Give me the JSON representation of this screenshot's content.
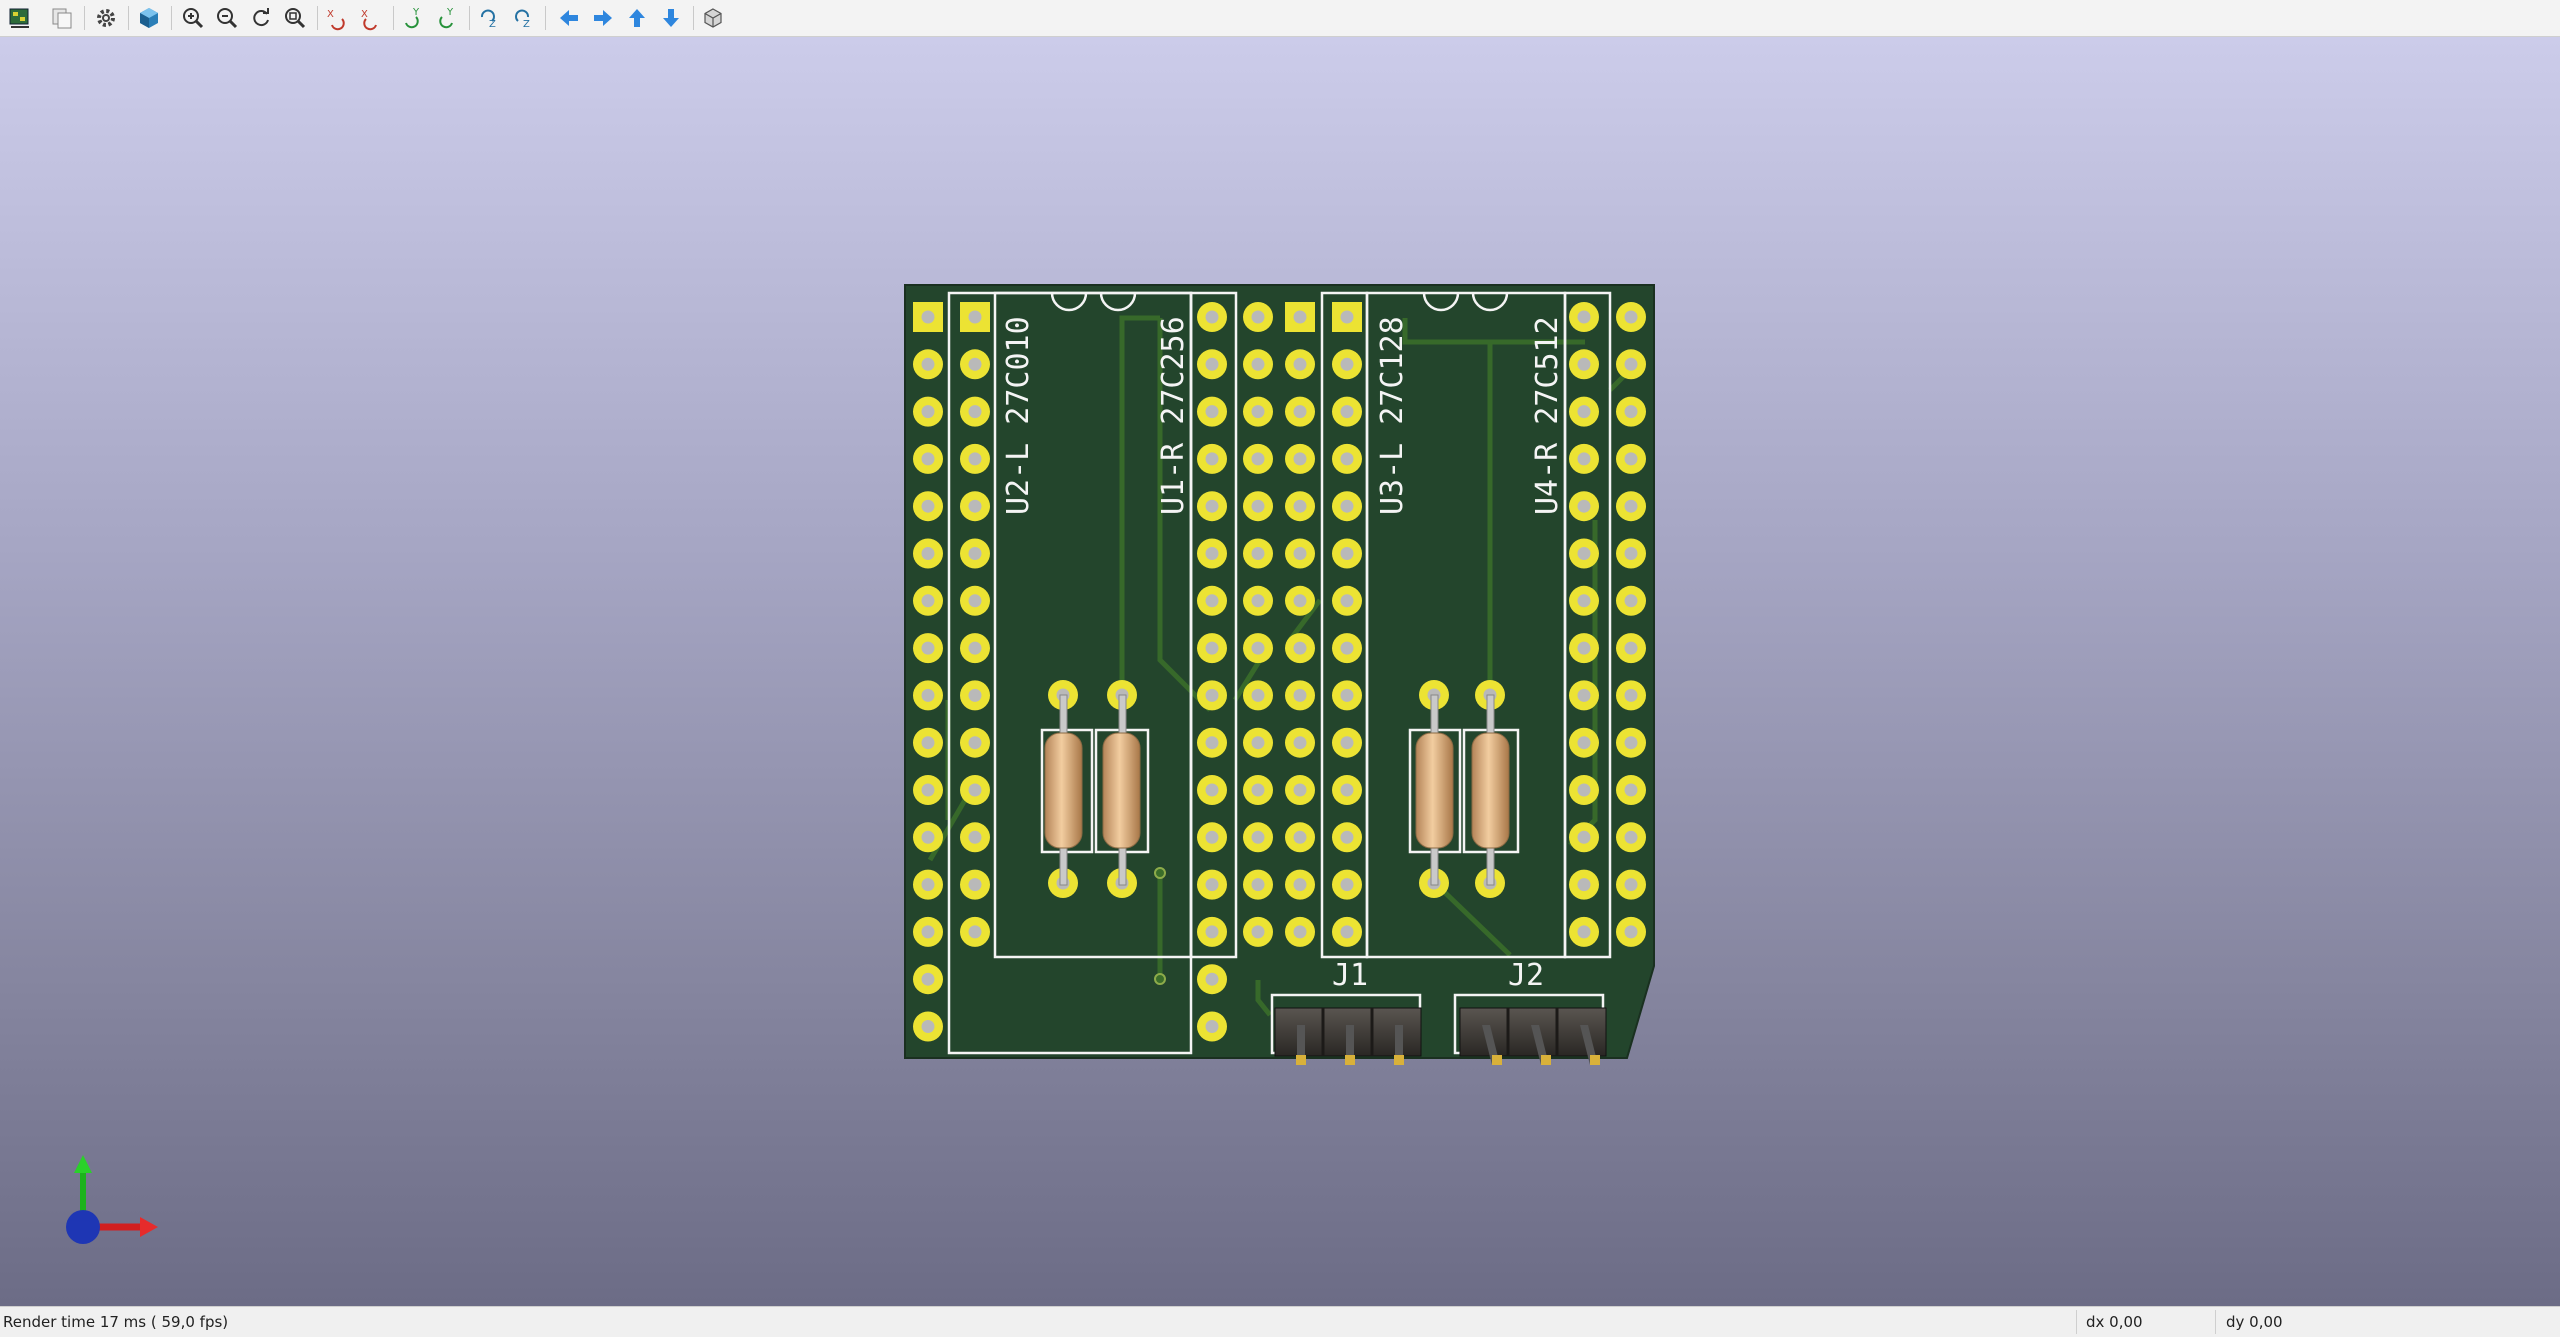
{
  "toolbar": {
    "icons": [
      "kicad-export-icon",
      "copy-image-icon",
      "settings-gear-icon",
      "3d-cube-icon",
      "zoom-in-icon",
      "zoom-out-icon",
      "redraw-icon",
      "zoom-fit-icon",
      "rotate-x-cw-icon",
      "rotate-x-ccw-icon",
      "rotate-y-cw-icon",
      "rotate-y-ccw-icon",
      "rotate-z-cw-icon",
      "rotate-z-ccw-icon",
      "move-left-icon",
      "move-right-icon",
      "move-up-icon",
      "move-down-icon",
      "ortho-view-icon"
    ]
  },
  "board": {
    "silkscreen": {
      "u2": "U2-L 27C010",
      "u1": "U1-R 27C256",
      "u3": "U3-L 27C128",
      "u4": "U4-R 27C512",
      "j1": "J1",
      "j2": "J2"
    },
    "colors": {
      "pcb": "#23452c",
      "pad": "#ece333",
      "silk": "#f4f4f4",
      "trace": "#3a6d2a"
    }
  },
  "statusbar": {
    "render_time": "Render time 17 ms ( 59,0 fps)",
    "dx": "dx 0,00",
    "dy": "dy 0,00"
  }
}
